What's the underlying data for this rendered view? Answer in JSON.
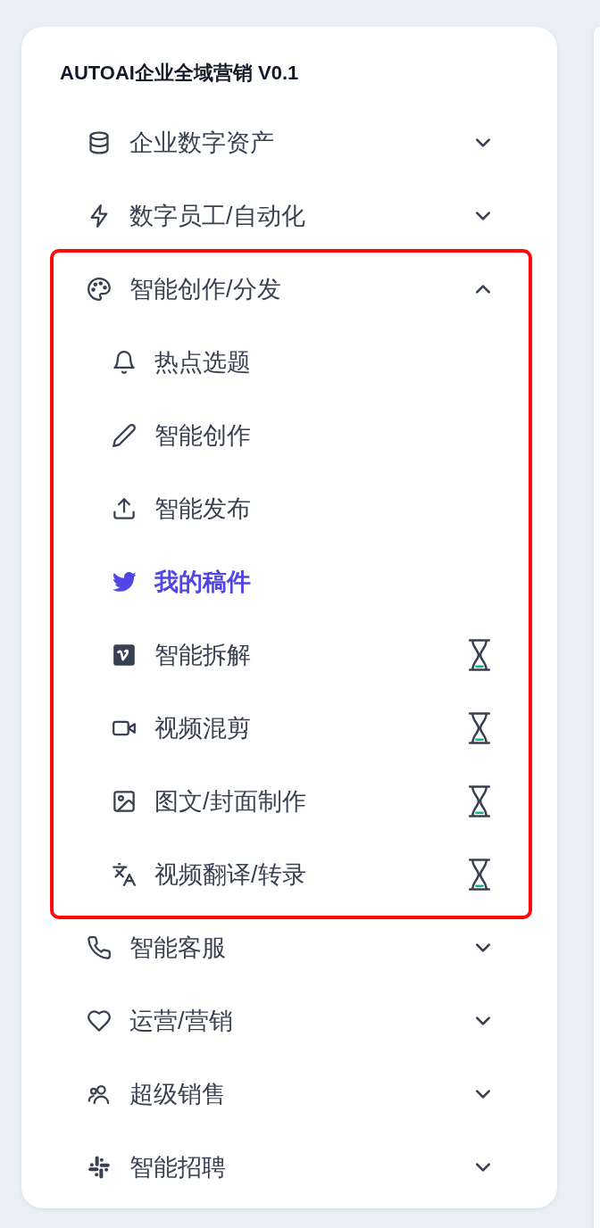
{
  "title": "AUTOAI企业全域营销 V0.1",
  "menu": [
    {
      "label": "企业数字资产",
      "expanded": false,
      "highlighted": false
    },
    {
      "label": "数字员工/自动化",
      "expanded": false,
      "highlighted": false
    },
    {
      "label": "智能创作/分发",
      "expanded": true,
      "highlighted": true,
      "children": [
        {
          "label": "热点选题",
          "selected": false,
          "pending": false
        },
        {
          "label": "智能创作",
          "selected": false,
          "pending": false
        },
        {
          "label": "智能发布",
          "selected": false,
          "pending": false
        },
        {
          "label": "我的稿件",
          "selected": true,
          "pending": false
        },
        {
          "label": "智能拆解",
          "selected": false,
          "pending": true
        },
        {
          "label": "视频混剪",
          "selected": false,
          "pending": true
        },
        {
          "label": "图文/封面制作",
          "selected": false,
          "pending": true
        },
        {
          "label": "视频翻译/转录",
          "selected": false,
          "pending": true
        }
      ]
    },
    {
      "label": "智能客服",
      "expanded": false,
      "highlighted": false
    },
    {
      "label": "运营/营销",
      "expanded": false,
      "highlighted": false
    },
    {
      "label": "超级销售",
      "expanded": false,
      "highlighted": false
    },
    {
      "label": "智能招聘",
      "expanded": false,
      "highlighted": false
    }
  ]
}
